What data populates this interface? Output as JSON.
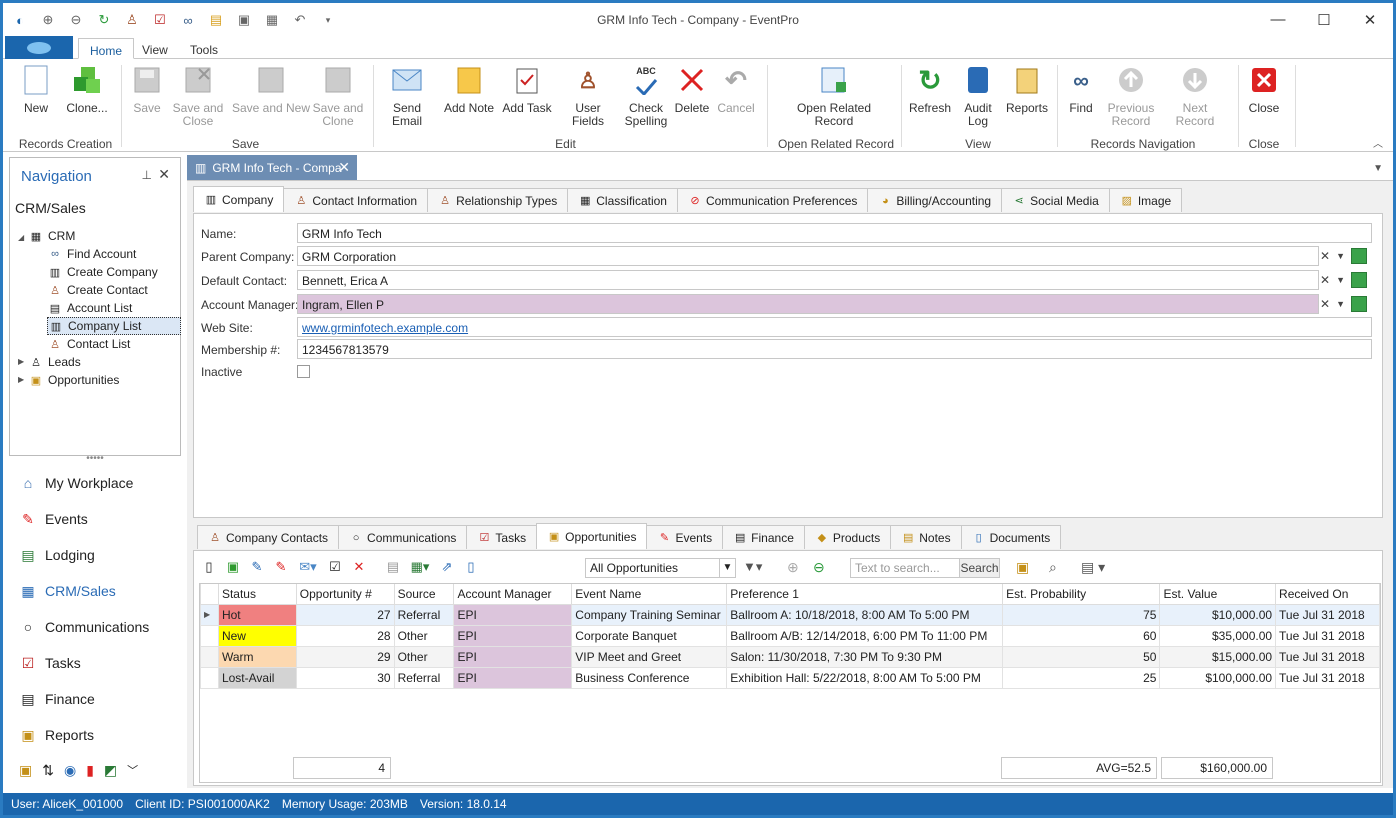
{
  "window": {
    "title": "GRM Info Tech - Company - EventPro",
    "minimize": "—",
    "maximize": "☐",
    "close": "✕"
  },
  "menu": {
    "tabs": [
      "Home",
      "View",
      "Tools"
    ]
  },
  "ribbon": {
    "buttons": [
      {
        "label": "New",
        "enabled": true
      },
      {
        "label": "Clone...",
        "enabled": true
      },
      {
        "label": "Save",
        "enabled": false
      },
      {
        "label": "Save and Close",
        "enabled": false
      },
      {
        "label": "Save and New",
        "enabled": false
      },
      {
        "label": "Save and Clone",
        "enabled": false
      },
      {
        "label": "Send Email",
        "enabled": true
      },
      {
        "label": "Add Note",
        "enabled": true
      },
      {
        "label": "Add Task",
        "enabled": true
      },
      {
        "label": "User Fields",
        "enabled": true
      },
      {
        "label": "Check Spelling",
        "enabled": true
      },
      {
        "label": "Delete",
        "enabled": true
      },
      {
        "label": "Cancel",
        "enabled": false
      },
      {
        "label": "Open Related Record",
        "enabled": true
      },
      {
        "label": "Refresh",
        "enabled": true
      },
      {
        "label": "Audit Log",
        "enabled": true
      },
      {
        "label": "Reports",
        "enabled": true
      },
      {
        "label": "Find",
        "enabled": true
      },
      {
        "label": "Previous Record",
        "enabled": false
      },
      {
        "label": "Next Record",
        "enabled": false
      },
      {
        "label": "Close",
        "enabled": true
      }
    ],
    "groups": [
      "Records Creation",
      "Save",
      "Edit",
      "Open Related Record",
      "View",
      "Records Navigation",
      "Close"
    ],
    "spelling_badge": "ABC"
  },
  "nav": {
    "title": "Navigation",
    "section": "CRM/Sales",
    "tree": {
      "root": "CRM",
      "children": [
        "Find Account",
        "Create Company",
        "Create Contact",
        "Account List",
        "Company List",
        "Contact List"
      ],
      "siblings": [
        "Leads",
        "Opportunities"
      ]
    },
    "modules": [
      "My Workplace",
      "Events",
      "Lodging",
      "CRM/Sales",
      "Communications",
      "Tasks",
      "Finance",
      "Reports"
    ]
  },
  "doc": {
    "tab_title": "GRM Info Tech - Compa"
  },
  "company_tabs": [
    "Company",
    "Contact Information",
    "Relationship Types",
    "Classification",
    "Communication Preferences",
    "Billing/Accounting",
    "Social Media",
    "Image"
  ],
  "form": {
    "name_label": "Name:",
    "name": "GRM Info Tech",
    "parent_label": "Parent Company:",
    "parent": "GRM Corporation",
    "contact_label": "Default Contact:",
    "contact": "Bennett, Erica A",
    "manager_label": "Account Manager:",
    "manager": "Ingram, Ellen P",
    "web_label": "Web Site:",
    "web": "www.grminfotech.example.com",
    "membership_label": "Membership #:",
    "membership": "1234567813579",
    "inactive_label": "Inactive",
    "manager_color": "#dcc5dc"
  },
  "sub_tabs": [
    "Company Contacts",
    "Communications",
    "Tasks",
    "Opportunities",
    "Events",
    "Finance",
    "Products",
    "Notes",
    "Documents"
  ],
  "grid_toolbar": {
    "filter": "All Opportunities",
    "search_placeholder": "Text to search...",
    "search_button": "Search"
  },
  "grid": {
    "columns": [
      "Status",
      "Opportunity #",
      "Source",
      "Account Manager",
      "Event Name",
      "Preference 1",
      "Est. Probability",
      "Est. Value",
      "Received On"
    ],
    "rows": [
      {
        "status": "Hot",
        "status_color": "#f08080",
        "opp": "27",
        "source": "Referral",
        "manager": "EPI",
        "event": "Company Training Seminar",
        "pref": "Ballroom A: 10/18/2018, 8:00 AM To 5:00 PM",
        "prob": "75",
        "value": "$10,000.00",
        "received": "Tue Jul 31 2018"
      },
      {
        "status": "New",
        "status_color": "#ffff00",
        "opp": "28",
        "source": "Other",
        "manager": "EPI",
        "event": "Corporate Banquet",
        "pref": "Ballroom A/B: 12/14/2018, 6:00 PM To 11:00 PM",
        "prob": "60",
        "value": "$35,000.00",
        "received": "Tue Jul 31 2018"
      },
      {
        "status": "Warm",
        "status_color": "#fcd8b0",
        "opp": "29",
        "source": "Other",
        "manager": "EPI",
        "event": "VIP Meet and Greet",
        "pref": "Salon: 11/30/2018, 7:30 PM To 9:30 PM",
        "prob": "50",
        "value": "$15,000.00",
        "received": "Tue Jul 31 2018"
      },
      {
        "status": "Lost-Avail",
        "status_color": "#d3d3d3",
        "opp": "30",
        "source": "Referral",
        "manager": "EPI",
        "event": "Business Conference",
        "pref": "Exhibition Hall: 5/22/2018, 8:00 AM To 5:00 PM",
        "prob": "25",
        "value": "$100,000.00",
        "received": "Tue Jul 31 2018"
      }
    ],
    "footer": {
      "count": "4",
      "avg": "AVG=52.5",
      "total": "$160,000.00"
    }
  },
  "status": {
    "user": "User: AliceK_001000",
    "client": "Client ID: PSI001000AK2",
    "memory": "Memory Usage: 203MB",
    "version": "Version: 18.0.14"
  }
}
